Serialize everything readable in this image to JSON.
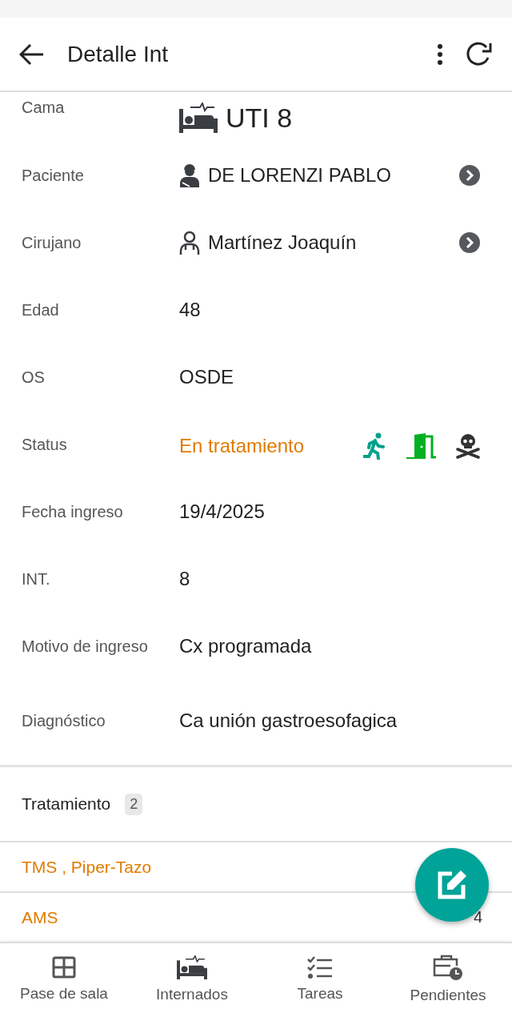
{
  "app_bar": {
    "title": "Detalle Int"
  },
  "details": [
    {
      "kind": "bed",
      "label": "Cama",
      "value": "UTI 8"
    },
    {
      "kind": "patient",
      "label": "Paciente",
      "value": "DE LORENZI PABLO"
    },
    {
      "kind": "doctor",
      "label": "Cirujano",
      "value": "Martínez Joaquín"
    },
    {
      "kind": "text",
      "label": "Edad",
      "value": "48"
    },
    {
      "kind": "text",
      "label": "OS",
      "value": "OSDE"
    },
    {
      "kind": "status",
      "label": "Status",
      "value": "En tratamiento",
      "color": "#e07b00"
    },
    {
      "kind": "text",
      "label": "Fecha ingreso",
      "value": "19/4/2025"
    },
    {
      "kind": "text",
      "label": "INT.",
      "value": "8"
    },
    {
      "kind": "text",
      "label": "Motivo de ingreso",
      "value": "Cx programada"
    },
    {
      "kind": "text",
      "label": "Diagnóstico",
      "value": "Ca unión gastroesofagica"
    }
  ],
  "treatment": {
    "title": "Tratamiento",
    "count": "2",
    "rows": [
      {
        "name": "TMS , Piper-Tazo"
      },
      {
        "name": "AMS",
        "day": "4"
      }
    ]
  },
  "bottom_nav": [
    {
      "kind": "grid",
      "label": "Pase de sala"
    },
    {
      "kind": "bed",
      "label": "Internados"
    },
    {
      "kind": "tasks",
      "label": "Tareas"
    },
    {
      "kind": "case",
      "label": "Pendientes"
    }
  ]
}
